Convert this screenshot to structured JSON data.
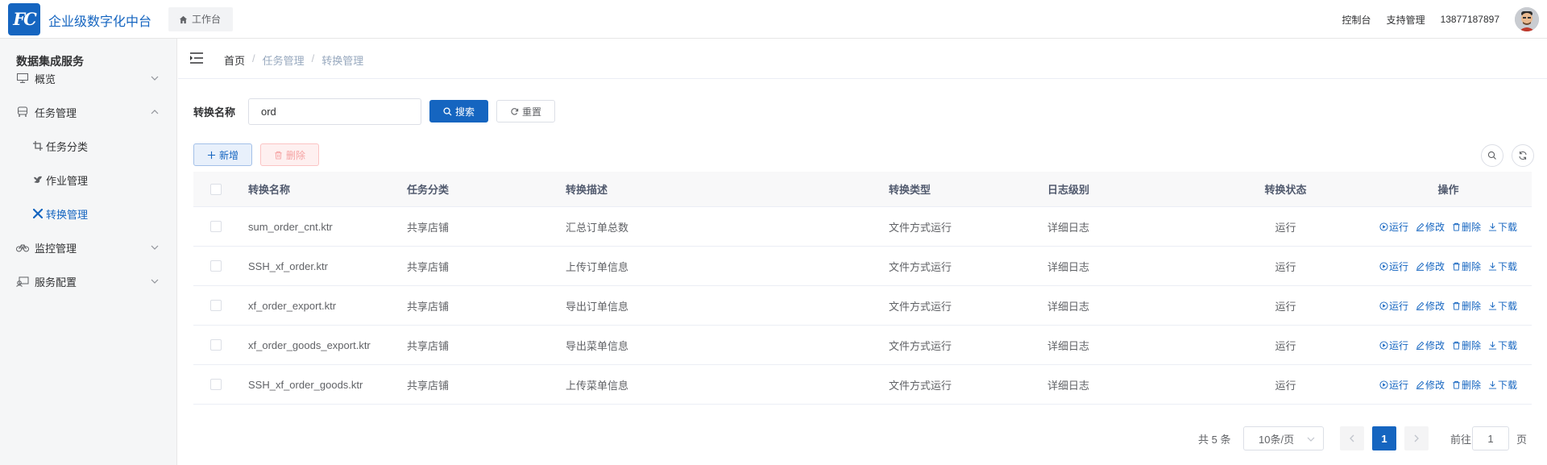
{
  "app": {
    "logo_text": "FC",
    "title": "企业级数字化中台",
    "workspace_tab": "工作台"
  },
  "header": {
    "links": [
      "控制台",
      "支持管理",
      "13877187897"
    ]
  },
  "sidebar": {
    "title": "数据集成服务",
    "items": [
      {
        "label": "概览",
        "icon": "monitor-icon",
        "expanded": false
      },
      {
        "label": "任务管理",
        "icon": "bus-icon",
        "expanded": true
      },
      {
        "label": "任务分类",
        "icon": "crop-icon",
        "sub": true
      },
      {
        "label": "作业管理",
        "icon": "bird-icon",
        "sub": true
      },
      {
        "label": "转换管理",
        "icon": "kettle-icon",
        "sub": true,
        "active": true
      },
      {
        "label": "监控管理",
        "icon": "bike-icon",
        "expanded": false
      },
      {
        "label": "服务配置",
        "icon": "config-icon",
        "expanded": false
      }
    ]
  },
  "breadcrumb": {
    "home": "首页",
    "level1": "任务管理",
    "level2": "转换管理"
  },
  "filter": {
    "label": "转换名称",
    "value": "ord",
    "search": "搜索",
    "reset": "重置"
  },
  "toolbar": {
    "add": "新增",
    "delete": "删除"
  },
  "table": {
    "headers": [
      "转换名称",
      "任务分类",
      "转换描述",
      "转换类型",
      "日志级别",
      "转换状态",
      "操作"
    ],
    "rows": [
      [
        "sum_order_cnt.ktr",
        "共享店铺",
        "汇总订单总数",
        "文件方式运行",
        "详细日志",
        "运行"
      ],
      [
        "SSH_xf_order.ktr",
        "共享店铺",
        "上传订单信息",
        "文件方式运行",
        "详细日志",
        "运行"
      ],
      [
        "xf_order_export.ktr",
        "共享店铺",
        "导出订单信息",
        "文件方式运行",
        "详细日志",
        "运行"
      ],
      [
        "xf_order_goods_export.ktr",
        "共享店铺",
        "导出菜单信息",
        "文件方式运行",
        "详细日志",
        "运行"
      ],
      [
        "SSH_xf_order_goods.ktr",
        "共享店铺",
        "上传菜单信息",
        "文件方式运行",
        "详细日志",
        "运行"
      ]
    ],
    "ops": [
      "运行",
      "修改",
      "删除",
      "下载"
    ]
  },
  "pagination": {
    "total": "共 5 条",
    "page_size": "10条/页",
    "current": "1",
    "goto_label": "前往",
    "goto_value": "1",
    "page_unit": "页"
  },
  "colors": {
    "primary": "#1565c0",
    "sidebar_bg": "#f5f6f7",
    "danger_light": "#fef0f0"
  }
}
